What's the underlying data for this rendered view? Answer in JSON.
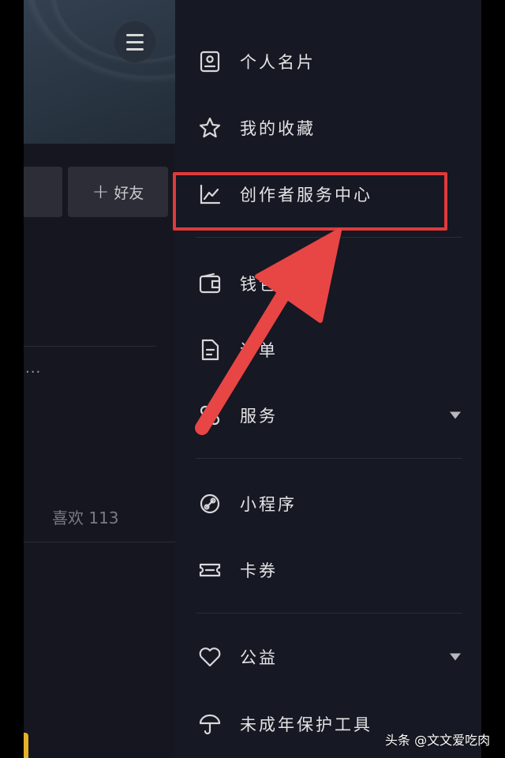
{
  "profile": {
    "add_friend_label": "好友",
    "likes_text": "喜欢 113",
    "overflow_dots": "..."
  },
  "drawer": {
    "items": [
      {
        "label": "个人名片",
        "icon": "id-card-icon"
      },
      {
        "label": "我的收藏",
        "icon": "star-icon"
      },
      {
        "label": "创作者服务中心",
        "icon": "chart-line-icon"
      },
      {
        "label": "钱包",
        "icon": "wallet-icon"
      },
      {
        "label": "订单",
        "icon": "document-icon"
      },
      {
        "label": "服务",
        "icon": "services-icon"
      },
      {
        "label": "小程序",
        "icon": "mini-program-icon"
      },
      {
        "label": "卡券",
        "icon": "ticket-icon"
      },
      {
        "label": "公益",
        "icon": "heart-icon"
      },
      {
        "label": "未成年保护工具",
        "icon": "umbrella-icon"
      }
    ]
  },
  "annotation": {
    "highlight_color": "#e03a3a"
  },
  "watermark": "头条 @文文爱吃肉"
}
